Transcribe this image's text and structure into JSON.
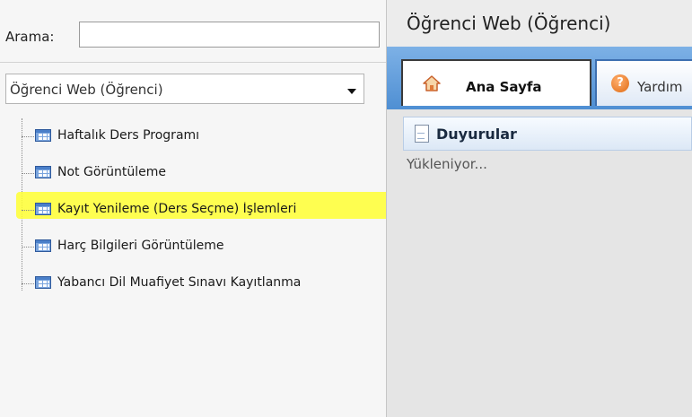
{
  "search": {
    "label": "Arama:",
    "value": "",
    "placeholder": ""
  },
  "module_select": {
    "selected": "Öğrenci Web (Öğrenci)"
  },
  "tree": {
    "items": [
      {
        "label": "Haftalık Ders Programı"
      },
      {
        "label": "Not Görüntüleme"
      },
      {
        "label": "Kayıt Yenileme (Ders Seçme) İşlemleri"
      },
      {
        "label": "Harç Bilgileri Görüntüleme"
      },
      {
        "label": "Yabancı Dil Muafiyet Sınavı Kayıtlanma"
      }
    ],
    "highlighted_index": 2,
    "highlight_color": "#ffff33"
  },
  "app": {
    "title": "Öğrenci Web (Öğrenci)"
  },
  "tabs": [
    {
      "label": "Ana Sayfa",
      "icon": "home-icon",
      "active": true
    },
    {
      "label": "Yardım",
      "icon": "help-icon",
      "active": false
    }
  ],
  "announcements": {
    "title": "Duyurular",
    "icon": "document-icon",
    "status": "Yükleniyor..."
  },
  "colors": {
    "tab_strip": "#4f8fd3",
    "accent": "#3d6fb0",
    "help_icon": "#e06a12"
  }
}
